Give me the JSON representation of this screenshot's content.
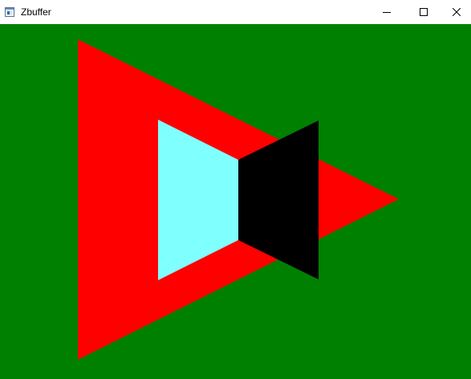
{
  "window": {
    "title": "Zbuffer",
    "controls": [
      "minimize",
      "maximize",
      "close"
    ]
  },
  "icons": {
    "app": "app-window-icon",
    "minimize": "minimize-icon",
    "maximize": "maximize-icon",
    "close": "close-icon"
  },
  "colors": {
    "background": "#008000",
    "triangle": "#ff0000",
    "left_quad": "#80ffff",
    "right_quad": "#000000",
    "titlebar": "#ffffff"
  }
}
